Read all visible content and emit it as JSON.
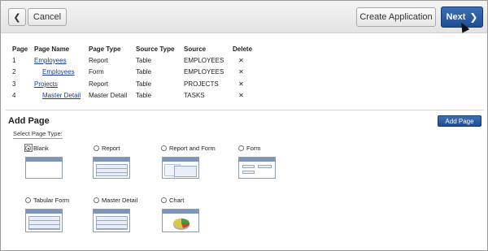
{
  "toolbar": {
    "cancel_label": "Cancel",
    "create_label": "Create Application",
    "next_label": "Next",
    "next_chevron": "❯",
    "back_chevron": "❮"
  },
  "pages_table": {
    "headers": [
      "Page",
      "Page Name",
      "Page Type",
      "Source Type",
      "Source",
      "Delete"
    ],
    "rows": [
      {
        "page": "1",
        "name": "Employees",
        "type": "Report",
        "source_type": "Table",
        "source": "EMPLOYEES",
        "delete": "✕"
      },
      {
        "page": "2",
        "name": "Employees",
        "type": "Form",
        "source_type": "Table",
        "source": "EMPLOYEES",
        "delete": "✕"
      },
      {
        "page": "3",
        "name": "Projects",
        "type": "Report",
        "source_type": "Table",
        "source": "PROJECTS",
        "delete": "✕"
      },
      {
        "page": "4",
        "name": "Master Detail",
        "type": "Master Detail",
        "source_type": "Table",
        "source": "TASKS",
        "delete": "✕"
      }
    ]
  },
  "add_page": {
    "title": "Add Page",
    "button_label": "Add Page",
    "select_label": "Select Page Type:",
    "options": [
      {
        "label": "Blank",
        "selected": true
      },
      {
        "label": "Report",
        "selected": false
      },
      {
        "label": "Report and Form",
        "selected": false
      },
      {
        "label": "Form",
        "selected": false
      },
      {
        "label": "Tabular Form",
        "selected": false
      },
      {
        "label": "Master Detail",
        "selected": false
      },
      {
        "label": "Chart",
        "selected": false
      }
    ]
  },
  "colors": {
    "primary_button": "#2a5aa0",
    "link": "#1a3d8f"
  }
}
